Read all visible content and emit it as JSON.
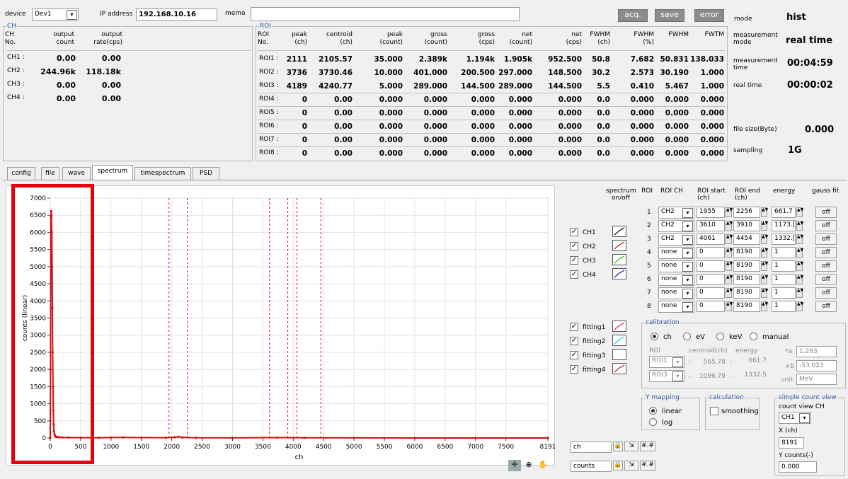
{
  "colors": {
    "accent_blue": "#2b4fa3",
    "plot_red": "#d01010",
    "highlight": "#e8000a"
  },
  "top": {
    "device_label": "device",
    "device_value": "Dev1",
    "ip_label": "IP address",
    "ip_value": "192.168.10.16",
    "memo_label": "memo",
    "memo_value": "",
    "acq_label": "acq.",
    "save_label": "save",
    "error_label": "error"
  },
  "status": {
    "mode_label": "mode",
    "mode_value": "hist",
    "mmode_label": "measurement mode",
    "mmode_value": "real time",
    "mtime_label": "measurement time",
    "mtime_value": "00:04:59",
    "rtime_label": "real time",
    "rtime_value": "00:00:02",
    "fsize_label": "file size(Byte)",
    "fsize_value": "0.000",
    "sampling_label": "sampling",
    "sampling_value": "1G"
  },
  "ch_panel": {
    "title": "CH",
    "headers": [
      "CH\nNo.",
      "output\ncount",
      "output\nrate(cps)"
    ],
    "rows": [
      [
        "CH1 :",
        "0.00",
        "0.00"
      ],
      [
        "CH2 :",
        "244.96k",
        "118.18k"
      ],
      [
        "CH3 :",
        "0.00",
        "0.00"
      ],
      [
        "CH4 :",
        "0.00",
        "0.00"
      ]
    ]
  },
  "roi_panel": {
    "title": "ROI",
    "headers": [
      "ROI\nNo.",
      "peak\n(ch)",
      "centroid\n(ch)",
      "peak\n(count)",
      "gross\n(count)",
      "gross\n(cps)",
      "net\n(count)",
      "net\n(cps)",
      "FWHM\n(ch)",
      "FWHM\n(%)",
      "FWHM",
      "FWTM"
    ],
    "rows": [
      [
        "ROI1 :",
        "2111",
        "2105.57",
        "35.000",
        "2.389k",
        "1.194k",
        "1.905k",
        "952.500",
        "50.8",
        "7.682",
        "50.831",
        "138.033"
      ],
      [
        "ROI2 :",
        "3736",
        "3730.46",
        "10.000",
        "401.000",
        "200.500",
        "297.000",
        "148.500",
        "30.2",
        "2.573",
        "30.190",
        "1.000"
      ],
      [
        "ROI3 :",
        "4189",
        "4240.77",
        "5.000",
        "289.000",
        "144.500",
        "289.000",
        "144.500",
        "5.5",
        "0.410",
        "5.467",
        "1.000"
      ],
      [
        "ROI4 :",
        "0",
        "0.00",
        "0.000",
        "0.000",
        "0.000",
        "0.000",
        "0.000",
        "0.0",
        "0.000",
        "0.000",
        "0.000"
      ],
      [
        "ROI5 :",
        "0",
        "0.00",
        "0.000",
        "0.000",
        "0.000",
        "0.000",
        "0.000",
        "0.0",
        "0.000",
        "0.000",
        "0.000"
      ],
      [
        "ROI6 :",
        "0",
        "0.00",
        "0.000",
        "0.000",
        "0.000",
        "0.000",
        "0.000",
        "0.0",
        "0.000",
        "0.000",
        "0.000"
      ],
      [
        "ROI7 :",
        "0",
        "0.00",
        "0.000",
        "0.000",
        "0.000",
        "0.000",
        "0.000",
        "0.0",
        "0.000",
        "0.000",
        "0.000"
      ],
      [
        "ROI8 :",
        "0",
        "0.00",
        "0.000",
        "0.000",
        "0.000",
        "0.000",
        "0.000",
        "0.0",
        "0.000",
        "0.000",
        "0.000"
      ]
    ]
  },
  "tabs": [
    "config",
    "file",
    "wave",
    "spectrum",
    "timespectrum",
    "PSD"
  ],
  "chart_data": {
    "type": "line",
    "xlabel": "ch",
    "ylabel": "counts (linear)",
    "xlim": [
      0,
      8191
    ],
    "ylim": [
      0,
      7000
    ],
    "xticks": [
      "0",
      "500",
      "1000",
      "1500",
      "2000",
      "2500",
      "3000",
      "3500",
      "4000",
      "4500",
      "5000",
      "5500",
      "6000",
      "6500",
      "7000",
      "7500",
      "8191"
    ],
    "xtick_values": [
      0,
      500,
      1000,
      1500,
      2000,
      2500,
      3000,
      3500,
      4000,
      4500,
      5000,
      5500,
      6000,
      6500,
      7000,
      7500,
      8191
    ],
    "yticks": [
      0,
      500,
      1000,
      1500,
      2000,
      2500,
      3000,
      3500,
      4000,
      4500,
      5000,
      5500,
      6000,
      6500,
      7000
    ],
    "grid": true,
    "roi_markers": [
      1955,
      2256,
      3610,
      3910,
      4061,
      4454
    ],
    "series": [
      {
        "name": "CH2",
        "color": "#d01010",
        "x": [
          0,
          5,
          10,
          15,
          20,
          25,
          30,
          35,
          40,
          45,
          50,
          55,
          60,
          70,
          80,
          90,
          100,
          120,
          150,
          200,
          300,
          500,
          800,
          1000,
          1200,
          1500,
          1900,
          2050,
          2111,
          2170,
          2400,
          3000,
          3736,
          4189,
          5000,
          6000,
          7000,
          8191
        ],
        "y": [
          0,
          2000,
          6450,
          6620,
          6500,
          6000,
          5000,
          3800,
          2500,
          1500,
          800,
          400,
          200,
          100,
          60,
          40,
          30,
          25,
          20,
          15,
          10,
          8,
          6,
          12,
          15,
          10,
          8,
          20,
          35,
          15,
          5,
          3,
          10,
          5,
          2,
          1,
          0,
          0
        ]
      }
    ]
  },
  "legend": {
    "header_spectrum": "spectrum on/off",
    "channels": [
      {
        "label": "CH1",
        "checked": true,
        "color": "#000000"
      },
      {
        "label": "CH2",
        "checked": true,
        "color": "#d01010"
      },
      {
        "label": "CH3",
        "checked": true,
        "color": "#18c018"
      },
      {
        "label": "CH4",
        "checked": true,
        "color": "#1010c0"
      }
    ],
    "fittings": [
      {
        "label": "fitting1",
        "checked": true,
        "color": "#e0208a"
      },
      {
        "label": "fitting2",
        "checked": true,
        "color": "#20c8d8"
      },
      {
        "label": "fitting3",
        "checked": true,
        "color": "#ffffff"
      },
      {
        "label": "fitting4",
        "checked": true,
        "color": "#d01010"
      }
    ]
  },
  "roi_settings": {
    "headers": [
      "ROI",
      "ROI CH",
      "ROI start (ch)",
      "ROI end (ch)",
      "energy",
      "gauss fit"
    ],
    "rows": [
      {
        "no": "1",
        "ch": "CH2",
        "start": "1955",
        "end": "2256",
        "energy": "661.7",
        "fit": "off"
      },
      {
        "no": "2",
        "ch": "CH2",
        "start": "3610",
        "end": "3910",
        "energy": "1173.[unclear]",
        "fit": "off"
      },
      {
        "no": "3",
        "ch": "CH2",
        "start": "4061",
        "end": "4454",
        "energy": "1332.[unclear]",
        "fit": "off"
      },
      {
        "no": "4",
        "ch": "none",
        "start": "0",
        "end": "8190",
        "energy": "1",
        "fit": "off"
      },
      {
        "no": "5",
        "ch": "none",
        "start": "0",
        "end": "8190",
        "energy": "1",
        "fit": "off"
      },
      {
        "no": "6",
        "ch": "none",
        "start": "0",
        "end": "8190",
        "energy": "1",
        "fit": "off"
      },
      {
        "no": "7",
        "ch": "none",
        "start": "0",
        "end": "8190",
        "energy": "1",
        "fit": "off"
      },
      {
        "no": "8",
        "ch": "none",
        "start": "0",
        "end": "8190",
        "energy": "1",
        "fit": "off"
      }
    ]
  },
  "calibration": {
    "title": "calibration",
    "options": [
      "ch",
      "eV",
      "keV",
      "manual"
    ],
    "selected": "ch",
    "col_roi": "ROI",
    "col_centroid": "centroid(ch)",
    "col_energy": "energy",
    "rows": [
      {
        "roi": "ROI1",
        "centroid": "565.78",
        "energy": "661.7"
      },
      {
        "roi": "ROI3",
        "centroid": "1096.79",
        "energy": "1332.5"
      }
    ],
    "a_label": "*a",
    "a_value": "1.263",
    "b_label": "+b",
    "b_value": "-53.023",
    "unit_label": "unit",
    "unit_value": "MeV"
  },
  "ymapping": {
    "title": "Y mapping",
    "options": [
      "linear",
      "log"
    ],
    "selected": "linear"
  },
  "calculation": {
    "title": "calculation",
    "smoothing_label": "smoothing",
    "smoothing_checked": false
  },
  "count_view": {
    "title": "simple count view",
    "ch_label": "count view CH",
    "ch_value": "CH1",
    "x_label": "X (ch)",
    "x_value": "8191",
    "y_label": "Y counts(-)",
    "y_value": "0.000"
  },
  "cursor": {
    "x_name": "ch",
    "y_name": "counts"
  }
}
